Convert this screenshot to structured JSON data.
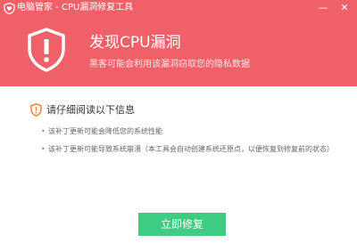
{
  "window": {
    "title": "电脑管家 - CPU漏洞修复工具"
  },
  "titlebar": {
    "minimize_label": "—",
    "close_label": "✕"
  },
  "icons": {
    "app_logo": "shield-heart-icon",
    "shield": "shield-alert-icon",
    "notice": "warning-shield-icon"
  },
  "colors": {
    "header_bg": "#f06068",
    "accent": "#e8813a",
    "button_bg": "#3dcc80"
  },
  "header": {
    "headline": "发现CPU漏洞",
    "subline": "黑客可能会利用该漏洞窃取您的隐私数据"
  },
  "notice": {
    "title": "请仔细阅读以下信息",
    "items": [
      {
        "bullet": "•",
        "text": "该补丁更新可能会降低您的系统性能"
      },
      {
        "bullet": "•",
        "text": "该补丁更新可能导致系统崩溃（本工具会自动创建系统还原点，以便恢复到修复前的状态）"
      }
    ]
  },
  "actions": {
    "repair_label": "立即修复"
  }
}
